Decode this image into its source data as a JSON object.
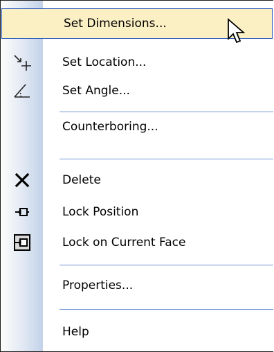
{
  "menu": {
    "items": [
      {
        "label": "Set Dimensions...",
        "icon": "none"
      },
      {
        "label": "Set Location...",
        "icon": "set-location-icon"
      },
      {
        "label": "Set Angle...",
        "icon": "set-angle-icon"
      },
      {
        "label": "Counterboring...",
        "icon": "none"
      },
      {
        "label": "Delete",
        "icon": "delete-x-icon"
      },
      {
        "label": "Lock Position",
        "icon": "pin-icon"
      },
      {
        "label": "Lock on Current Face",
        "icon": "pin-on-face-icon"
      },
      {
        "label": "Properties...",
        "icon": "none"
      },
      {
        "label": "Help",
        "icon": "none"
      }
    ]
  },
  "colors": {
    "highlight_bg": "#fbefc4",
    "highlight_border": "#2d5bbd",
    "separator": "#6f94d6",
    "gutter_light": "#fdfdfb",
    "gutter_dark": "#c3d2e8"
  }
}
